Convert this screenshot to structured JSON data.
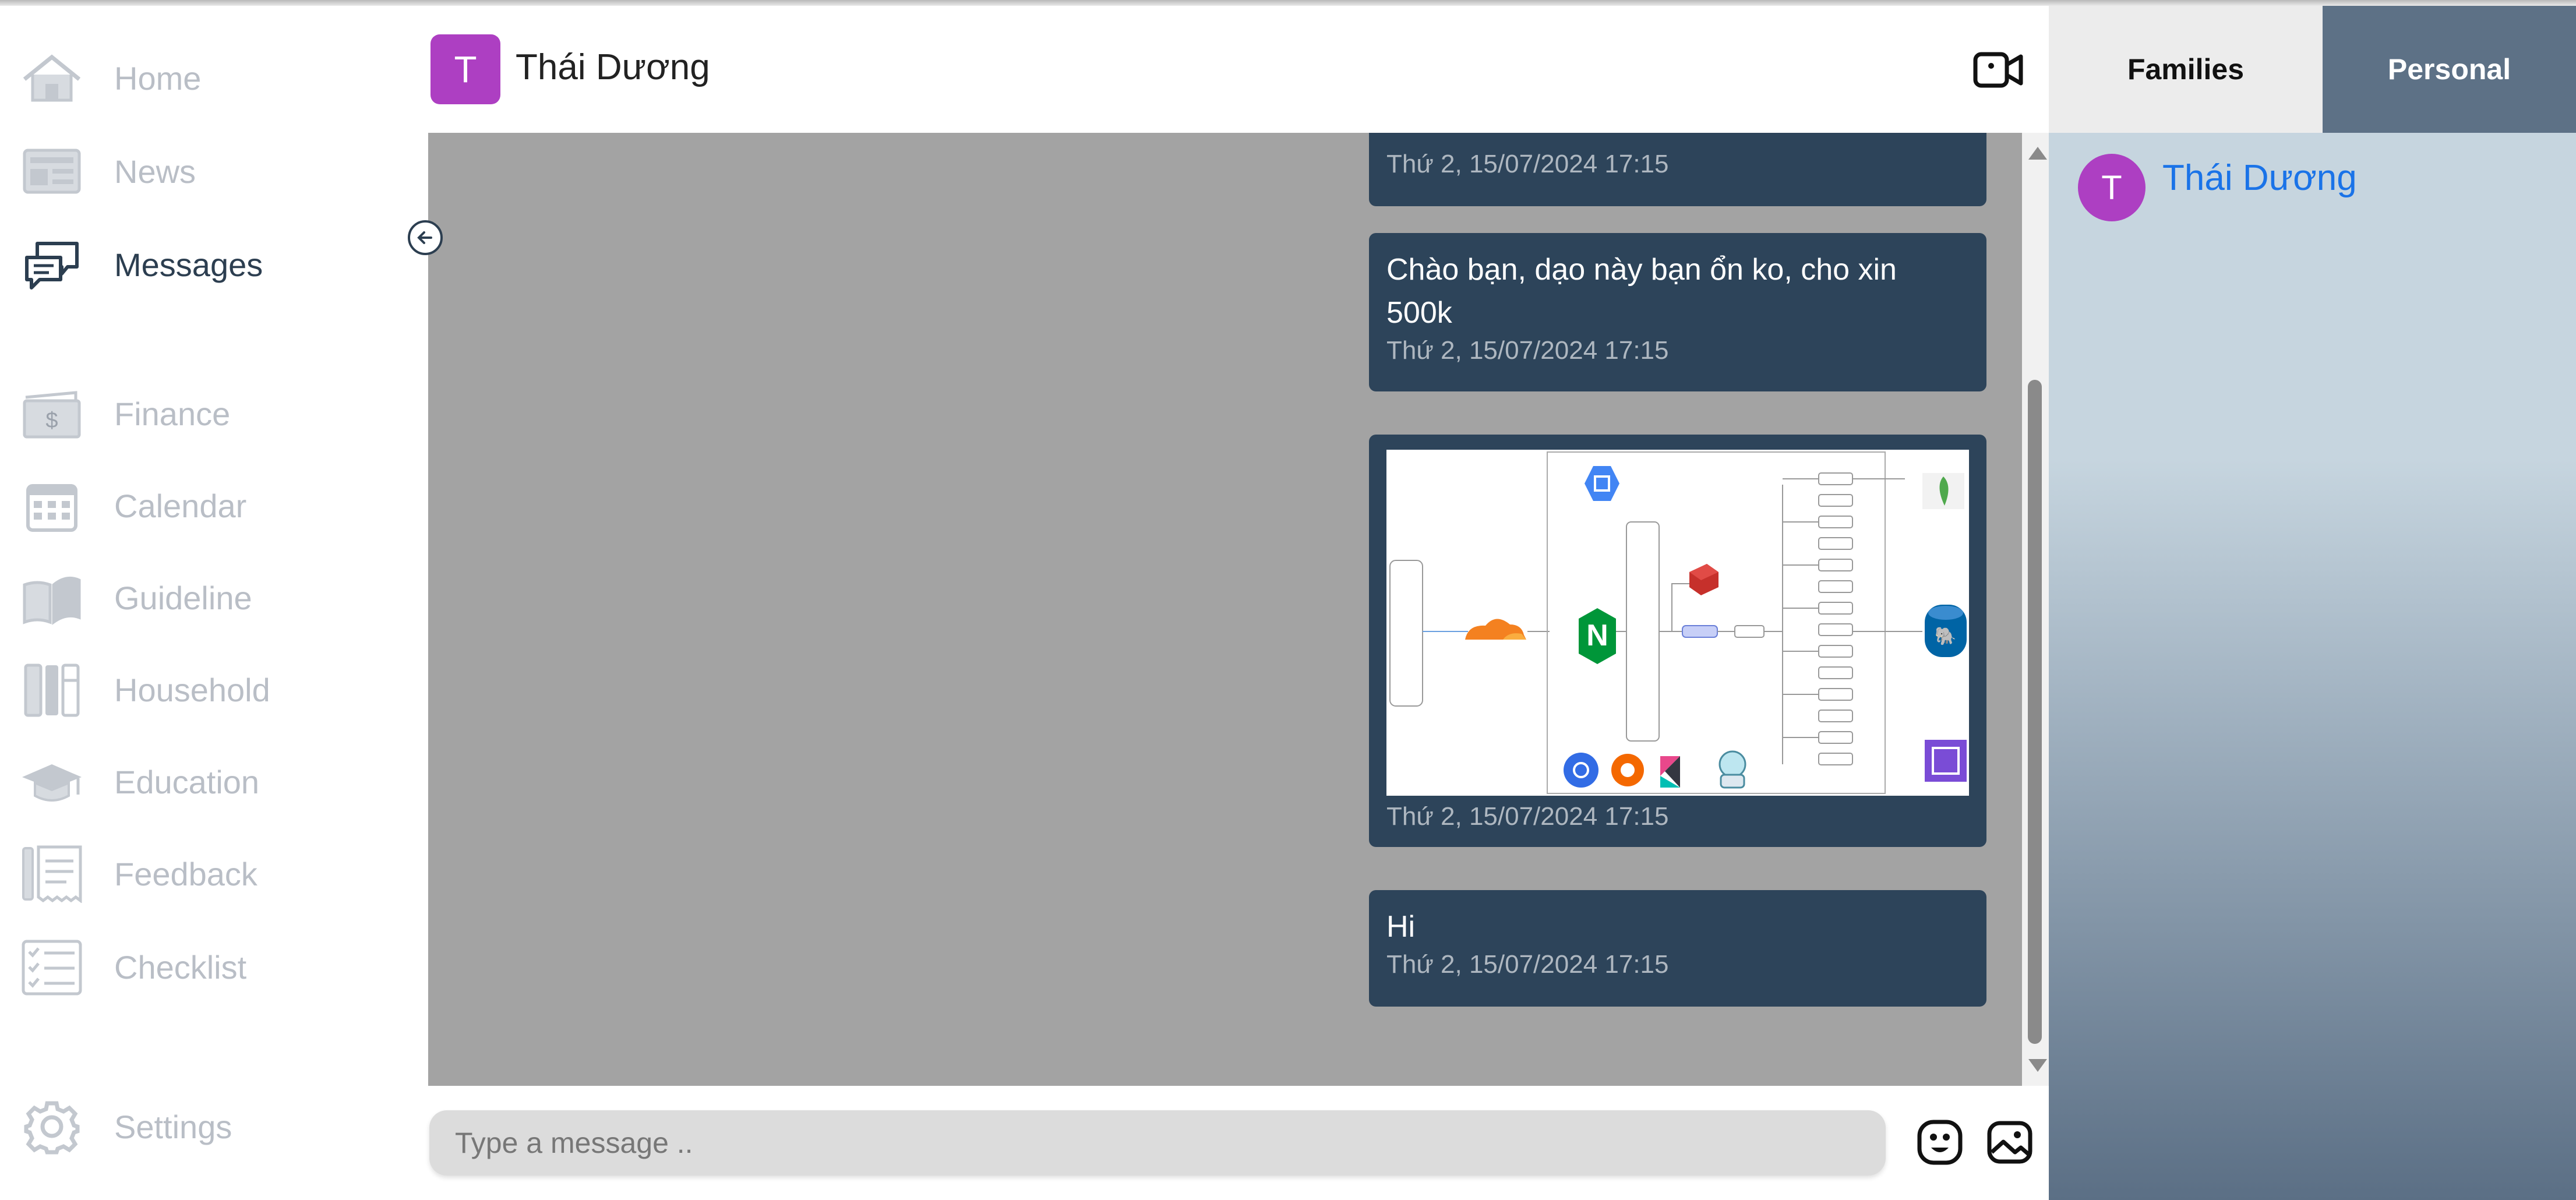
{
  "sidebar": {
    "items": [
      {
        "label": "Home",
        "icon": "home-icon",
        "active": false
      },
      {
        "label": "News",
        "icon": "news-icon",
        "active": false
      },
      {
        "label": "Messages",
        "icon": "messages-icon",
        "active": true
      },
      {
        "label": "Finance",
        "icon": "finance-icon",
        "active": false
      },
      {
        "label": "Calendar",
        "icon": "calendar-icon",
        "active": false
      },
      {
        "label": "Guideline",
        "icon": "book-icon",
        "active": false
      },
      {
        "label": "Household",
        "icon": "household-icon",
        "active": false
      },
      {
        "label": "Education",
        "icon": "graduation-cap-icon",
        "active": false
      },
      {
        "label": "Feedback",
        "icon": "feedback-icon",
        "active": false
      },
      {
        "label": "Checklist",
        "icon": "checklist-icon",
        "active": false
      },
      {
        "label": "Settings",
        "icon": "gear-icon",
        "active": false
      }
    ]
  },
  "chat": {
    "avatar_letter": "T",
    "title": "Thái Dương",
    "messages": [
      {
        "text": "",
        "time": "Thứ 2, 15/07/2024 17:15"
      },
      {
        "text": "Chào bạn, dạo này bạn ổn ko, cho xin 500k",
        "time": "Thứ 2, 15/07/2024 17:15"
      },
      {
        "text": "",
        "image": "architecture-diagram-image",
        "time": "Thứ 2, 15/07/2024 17:15"
      },
      {
        "text": "Hi",
        "time": "Thứ 2, 15/07/2024 17:15"
      }
    ],
    "input_placeholder": "Type a message .."
  },
  "right_panel": {
    "tabs": [
      {
        "label": "Families",
        "active": true
      },
      {
        "label": "Personal",
        "active": false
      }
    ],
    "contacts": [
      {
        "avatar_letter": "T",
        "name": "Thái Dương"
      }
    ]
  },
  "colors": {
    "bubble": "#2d445a",
    "chat_background": "#a3a3a3",
    "avatar": "#ad3fc2",
    "contact_link": "#1a73e8"
  }
}
